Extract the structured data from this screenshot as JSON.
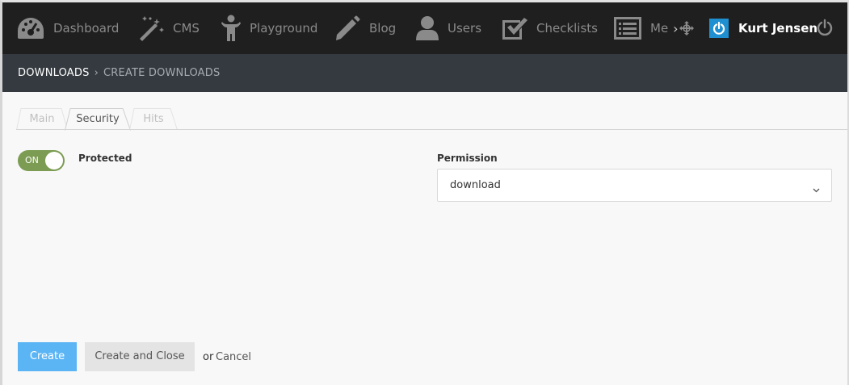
{
  "nav": {
    "items": [
      {
        "label": "Dashboard",
        "icon": "speedometer-icon"
      },
      {
        "label": "CMS",
        "icon": "magic-wand-icon"
      },
      {
        "label": "Playground",
        "icon": "child-figure-icon"
      },
      {
        "label": "Blog",
        "icon": "pencil-icon"
      },
      {
        "label": "Users",
        "icon": "user-icon"
      },
      {
        "label": "Checklists",
        "icon": "checkbox-icon"
      },
      {
        "label": "Me",
        "icon": "list-icon"
      }
    ],
    "overflow_glyph": "›",
    "user_name": "Kurt Jensen"
  },
  "breadcrumb": {
    "parent": "DOWNLOADS",
    "separator": "›",
    "current": "CREATE DOWNLOADS"
  },
  "tabs": [
    {
      "label": "Main",
      "active": false
    },
    {
      "label": "Security",
      "active": true
    },
    {
      "label": "Hits",
      "active": false
    }
  ],
  "form": {
    "protected_toggle_text": "ON",
    "protected_label": "Protected",
    "permission_label": "Permission",
    "permission_value": "download"
  },
  "actions": {
    "create": "Create",
    "create_close": "Create and Close",
    "or": "or",
    "cancel": "Cancel"
  },
  "colors": {
    "nav_bg": "#1f1f1f",
    "crumb_bg": "#343a40",
    "toggle_on": "#7b9c52",
    "primary": "#5bb5f5",
    "user_badge": "#1e8fd0"
  }
}
